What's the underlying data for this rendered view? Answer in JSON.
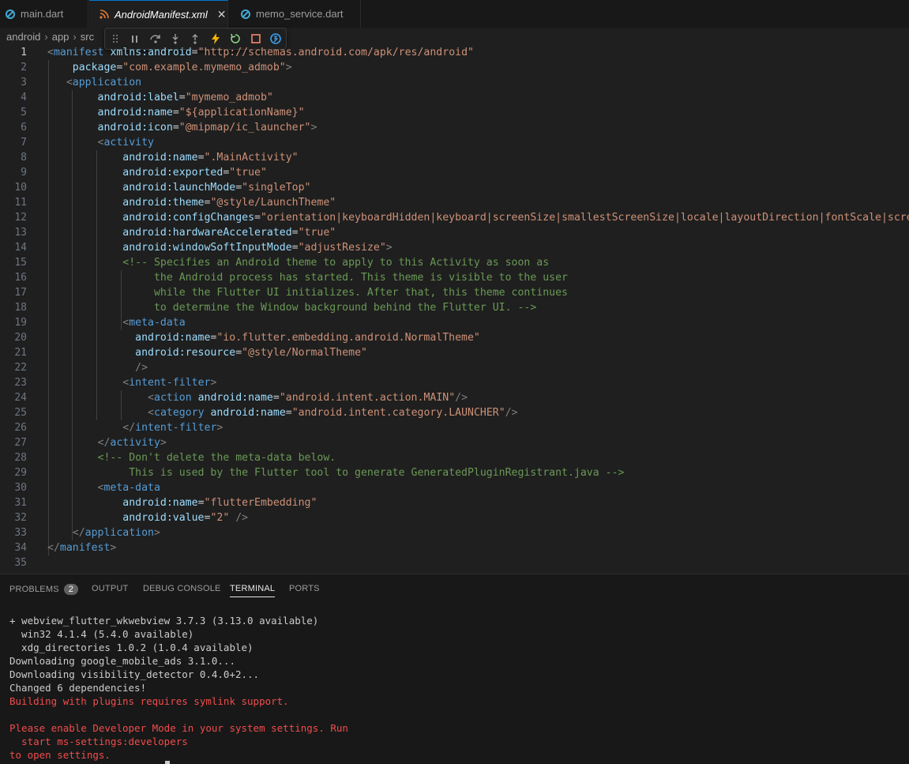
{
  "tabs": [
    {
      "label": "main.dart",
      "icon": "dart-icon"
    },
    {
      "label": "AndroidManifest.xml",
      "icon": "rss-xml-icon",
      "close": "✕"
    },
    {
      "label": "memo_service.dart",
      "icon": "dart-icon"
    }
  ],
  "breadcrumb": [
    "android",
    "app",
    "src"
  ],
  "debug_toolbar": [
    "drag-handle-icon",
    "pause-icon",
    "step-over-icon",
    "step-into-icon",
    "step-out-icon",
    "hot-reload-icon",
    "restart-icon",
    "stop-icon",
    "devtools-icon"
  ],
  "editor": {
    "current_line": 1,
    "lines": [
      [
        [
          "tg",
          "<"
        ],
        [
          "tn",
          "manifest"
        ],
        [
          "tx",
          " "
        ],
        [
          "at",
          "xmlns:android"
        ],
        [
          "tx",
          "="
        ],
        [
          "av",
          "\"http://schemas.android.com/apk/res/android\""
        ]
      ],
      [
        [
          "tx",
          "    "
        ],
        [
          "at",
          "package"
        ],
        [
          "tx",
          "="
        ],
        [
          "av",
          "\"com.example.mymemo_admob\""
        ],
        [
          "tg",
          ">"
        ]
      ],
      [
        [
          "tx",
          "   "
        ],
        [
          "tg",
          "<"
        ],
        [
          "tn",
          "application"
        ]
      ],
      [
        [
          "tx",
          "        "
        ],
        [
          "at",
          "android:label"
        ],
        [
          "tx",
          "="
        ],
        [
          "av",
          "\"mymemo_admob\""
        ]
      ],
      [
        [
          "tx",
          "        "
        ],
        [
          "at",
          "android:name"
        ],
        [
          "tx",
          "="
        ],
        [
          "av",
          "\"${applicationName}\""
        ]
      ],
      [
        [
          "tx",
          "        "
        ],
        [
          "at",
          "android:icon"
        ],
        [
          "tx",
          "="
        ],
        [
          "av",
          "\"@mipmap/ic_launcher\""
        ],
        [
          "tg",
          ">"
        ]
      ],
      [
        [
          "tx",
          "        "
        ],
        [
          "tg",
          "<"
        ],
        [
          "tn",
          "activity"
        ]
      ],
      [
        [
          "tx",
          "            "
        ],
        [
          "at",
          "android:name"
        ],
        [
          "tx",
          "="
        ],
        [
          "av",
          "\".MainActivity\""
        ]
      ],
      [
        [
          "tx",
          "            "
        ],
        [
          "at",
          "android:exported"
        ],
        [
          "tx",
          "="
        ],
        [
          "av",
          "\"true\""
        ]
      ],
      [
        [
          "tx",
          "            "
        ],
        [
          "at",
          "android:launchMode"
        ],
        [
          "tx",
          "="
        ],
        [
          "av",
          "\"singleTop\""
        ]
      ],
      [
        [
          "tx",
          "            "
        ],
        [
          "at",
          "android:theme"
        ],
        [
          "tx",
          "="
        ],
        [
          "av",
          "\"@style/LaunchTheme\""
        ]
      ],
      [
        [
          "tx",
          "            "
        ],
        [
          "at",
          "android:configChanges"
        ],
        [
          "tx",
          "="
        ],
        [
          "av",
          "\"orientation|keyboardHidden|keyboard|screenSize|smallestScreenSize|locale|layoutDirection|fontScale|screenLayout"
        ]
      ],
      [
        [
          "tx",
          "            "
        ],
        [
          "at",
          "android:hardwareAccelerated"
        ],
        [
          "tx",
          "="
        ],
        [
          "av",
          "\"true\""
        ]
      ],
      [
        [
          "tx",
          "            "
        ],
        [
          "at",
          "android:windowSoftInputMode"
        ],
        [
          "tx",
          "="
        ],
        [
          "av",
          "\"adjustResize\""
        ],
        [
          "tg",
          ">"
        ]
      ],
      [
        [
          "tx",
          "            "
        ],
        [
          "cm",
          "<!-- Specifies an Android theme to apply to this Activity as soon as"
        ]
      ],
      [
        [
          "tx",
          "                 "
        ],
        [
          "cm",
          "the Android process has started. This theme is visible to the user"
        ]
      ],
      [
        [
          "tx",
          "                 "
        ],
        [
          "cm",
          "while the Flutter UI initializes. After that, this theme continues"
        ]
      ],
      [
        [
          "tx",
          "                 "
        ],
        [
          "cm",
          "to determine the Window background behind the Flutter UI. -->"
        ]
      ],
      [
        [
          "tx",
          "            "
        ],
        [
          "tg",
          "<"
        ],
        [
          "tn",
          "meta-data"
        ]
      ],
      [
        [
          "tx",
          "              "
        ],
        [
          "at",
          "android:name"
        ],
        [
          "tx",
          "="
        ],
        [
          "av",
          "\"io.flutter.embedding.android.NormalTheme\""
        ]
      ],
      [
        [
          "tx",
          "              "
        ],
        [
          "at",
          "android:resource"
        ],
        [
          "tx",
          "="
        ],
        [
          "av",
          "\"@style/NormalTheme\""
        ]
      ],
      [
        [
          "tx",
          "              "
        ],
        [
          "tg",
          "/>"
        ]
      ],
      [
        [
          "tx",
          "            "
        ],
        [
          "tg",
          "<"
        ],
        [
          "tn",
          "intent-filter"
        ],
        [
          "tg",
          ">"
        ]
      ],
      [
        [
          "tx",
          "                "
        ],
        [
          "tg",
          "<"
        ],
        [
          "tn",
          "action"
        ],
        [
          "tx",
          " "
        ],
        [
          "at",
          "android:name"
        ],
        [
          "tx",
          "="
        ],
        [
          "av",
          "\"android.intent.action.MAIN\""
        ],
        [
          "tg",
          "/>"
        ]
      ],
      [
        [
          "tx",
          "                "
        ],
        [
          "tg",
          "<"
        ],
        [
          "tn",
          "category"
        ],
        [
          "tx",
          " "
        ],
        [
          "at",
          "android:name"
        ],
        [
          "tx",
          "="
        ],
        [
          "av",
          "\"android.intent.category.LAUNCHER\""
        ],
        [
          "tg",
          "/>"
        ]
      ],
      [
        [
          "tx",
          "            "
        ],
        [
          "tg",
          "</"
        ],
        [
          "tn",
          "intent-filter"
        ],
        [
          "tg",
          ">"
        ]
      ],
      [
        [
          "tx",
          "        "
        ],
        [
          "tg",
          "</"
        ],
        [
          "tn",
          "activity"
        ],
        [
          "tg",
          ">"
        ]
      ],
      [
        [
          "tx",
          "        "
        ],
        [
          "cm",
          "<!-- Don't delete the meta-data below."
        ]
      ],
      [
        [
          "tx",
          "             "
        ],
        [
          "cm",
          "This is used by the Flutter tool to generate GeneratedPluginRegistrant.java -->"
        ]
      ],
      [
        [
          "tx",
          "        "
        ],
        [
          "tg",
          "<"
        ],
        [
          "tn",
          "meta-data"
        ]
      ],
      [
        [
          "tx",
          "            "
        ],
        [
          "at",
          "android:name"
        ],
        [
          "tx",
          "="
        ],
        [
          "av",
          "\"flutterEmbedding\""
        ]
      ],
      [
        [
          "tx",
          "            "
        ],
        [
          "at",
          "android:value"
        ],
        [
          "tx",
          "="
        ],
        [
          "av",
          "\"2\""
        ],
        [
          "tx",
          " "
        ],
        [
          "tg",
          "/>"
        ]
      ],
      [
        [
          "tx",
          "    "
        ],
        [
          "tg",
          "</"
        ],
        [
          "tn",
          "application"
        ],
        [
          "tg",
          ">"
        ]
      ],
      [
        [
          "tg",
          "</"
        ],
        [
          "tn",
          "manifest"
        ],
        [
          "tg",
          ">"
        ]
      ],
      []
    ]
  },
  "panel": {
    "tabs": [
      {
        "label": "PROBLEMS",
        "badge": "2"
      },
      {
        "label": "OUTPUT"
      },
      {
        "label": "DEBUG CONSOLE"
      },
      {
        "label": "TERMINAL",
        "active": true
      },
      {
        "label": "PORTS"
      }
    ],
    "terminal": [
      {
        "text": "+ webview_flutter_wkwebview 3.7.3 (3.13.0 available)",
        "err": false
      },
      {
        "text": "  win32 4.1.4 (5.4.0 available)",
        "err": false
      },
      {
        "text": "  xdg_directories 1.0.2 (1.0.4 available)",
        "err": false
      },
      {
        "text": "Downloading google_mobile_ads 3.1.0...",
        "err": false
      },
      {
        "text": "Downloading visibility_detector 0.4.0+2...",
        "err": false
      },
      {
        "text": "Changed 6 dependencies!",
        "err": false
      },
      {
        "text": "Building with plugins requires symlink support.",
        "err": true
      },
      {
        "text": "",
        "err": false
      },
      {
        "text": "Please enable Developer Mode in your system settings. Run",
        "err": true
      },
      {
        "text": "  start ms-settings:developers",
        "err": true
      },
      {
        "text": "to open settings.",
        "err": true
      }
    ]
  }
}
